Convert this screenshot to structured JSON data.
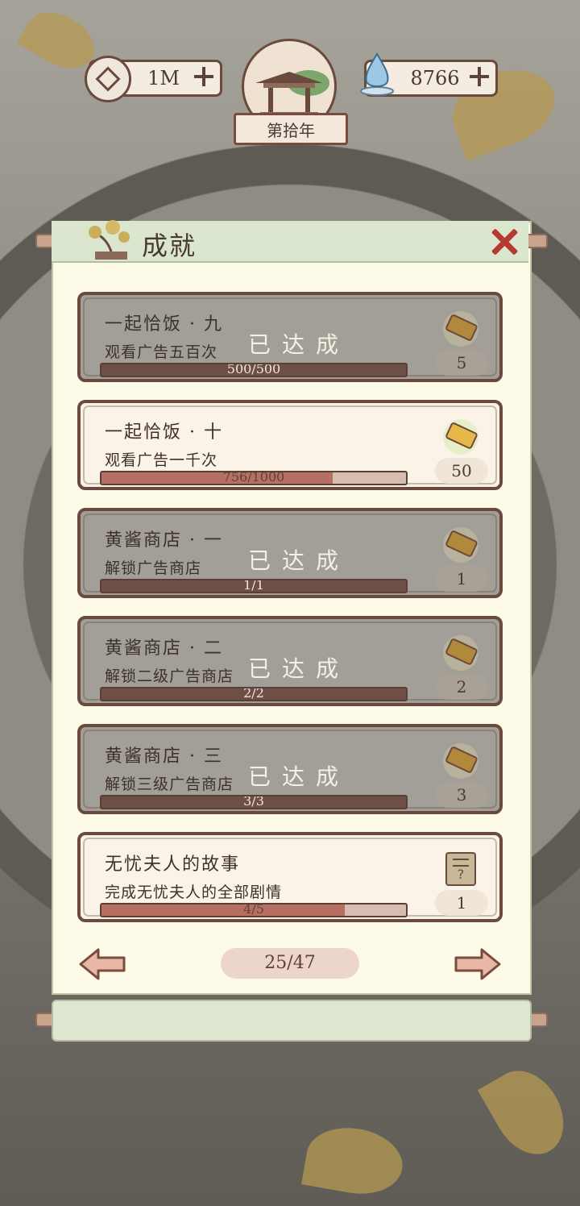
{
  "top_bar": {
    "coins": "1M",
    "spirit": "8766",
    "year": "第拾年"
  },
  "panel": {
    "title": "成就"
  },
  "achievements": [
    {
      "title": "一起恰饭 · 九",
      "desc": "观看广告五百次",
      "progress_text": "500/500",
      "progress": 1.0,
      "reward": "5",
      "completed": true,
      "done_label": "已达成"
    },
    {
      "title": "一起恰饭 · 十",
      "desc": "观看广告一千次",
      "progress_text": "756/1000",
      "progress": 0.756,
      "reward": "50",
      "completed": false,
      "done_label": ""
    },
    {
      "title": "黄酱商店 · 一",
      "desc": "解锁广告商店",
      "progress_text": "1/1",
      "progress": 1.0,
      "reward": "1",
      "completed": true,
      "done_label": "已达成"
    },
    {
      "title": "黄酱商店 · 二",
      "desc": "解锁二级广告商店",
      "progress_text": "2/2",
      "progress": 1.0,
      "reward": "2",
      "completed": true,
      "done_label": "已达成"
    },
    {
      "title": "黄酱商店 · 三",
      "desc": "解锁三级广告商店",
      "progress_text": "3/3",
      "progress": 1.0,
      "reward": "3",
      "completed": true,
      "done_label": "已达成"
    },
    {
      "title": "无忧夫人的故事",
      "desc": "完成无忧夫人的全部剧情",
      "progress_text": "4/5",
      "progress": 0.8,
      "reward": "1",
      "completed": false,
      "done_label": ""
    }
  ],
  "pagination": {
    "page": "25/47"
  },
  "icons": {
    "coin": "coin-icon",
    "spirit": "water-drop-icon",
    "ticket": "ticket-icon",
    "scroll": "scroll-icon",
    "close": "close-icon",
    "prev": "left-arrow-icon",
    "next": "right-arrow-icon"
  },
  "colors": {
    "completed_card": "#a29e98",
    "active_card": "#fbf3e8",
    "border": "#6b4a3e",
    "close": "#b43a32",
    "panel": "#fdfae8"
  }
}
